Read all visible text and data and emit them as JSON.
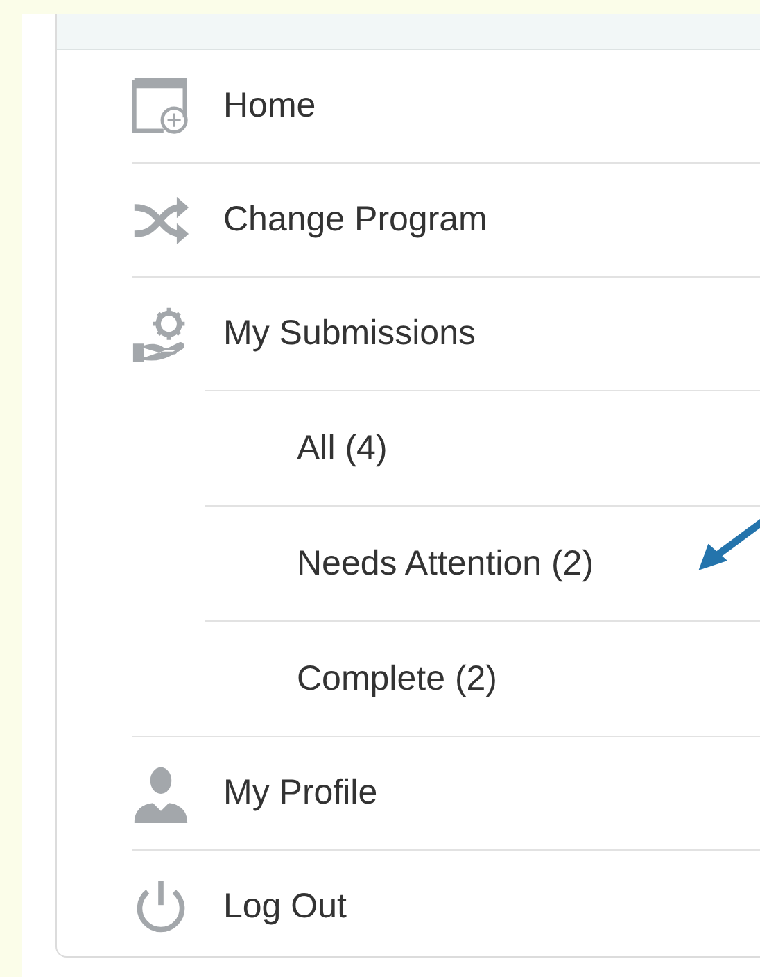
{
  "menu": [
    {
      "label": "Home"
    },
    {
      "label": "Change Program"
    },
    {
      "label": "My Submissions",
      "children": [
        {
          "label": "All (4)",
          "annotated": false
        },
        {
          "label": "Needs Attention (2)",
          "annotated": true
        },
        {
          "label": "Complete (2)",
          "annotated": false
        }
      ]
    },
    {
      "label": "My Profile"
    },
    {
      "label": "Log Out"
    }
  ]
}
